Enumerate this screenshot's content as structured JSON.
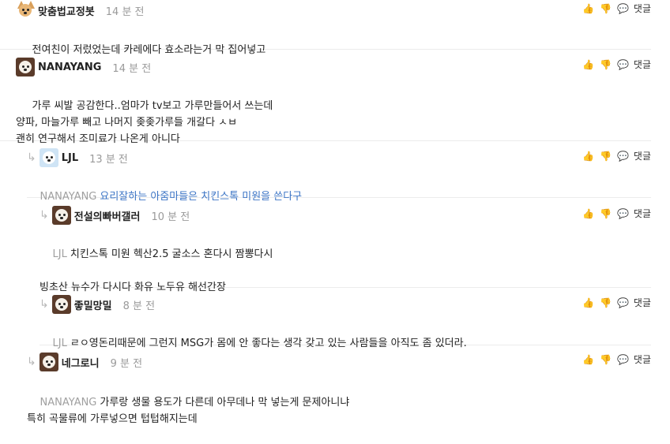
{
  "actions": {
    "like_icon": "thumbs-up-icon",
    "dislike_icon": "thumbs-down-icon",
    "reply_icon": "speech-bubble-icon",
    "reply_label": "댓글"
  },
  "comments": [
    {
      "name": "맞춤법교정봇",
      "time": "14 분 전",
      "avatar": "shiba",
      "mention": "",
      "text": "전여친이 저렀었는데 카레에다 효소라는거 막 집어넣고"
    },
    {
      "name": "NANAYANG",
      "time": "14 분 전",
      "avatar": "dog",
      "mention": "",
      "text": "가루 씨발 공감한다..엄마가 tv보고 가루만들어서 쓰는데\n양파, 마늘가루 빼고 나머지 좆좆가루들 개갈다 ㅅㅂ\n괜히 연구해서 조미료가 나온게 아니다"
    },
    {
      "name": "LJL",
      "time": "13 분 전",
      "avatar": "blue",
      "mention": "NANAYANG",
      "text": "요리잘하는 아줌마들은 치킨스톡 미원을 쓴다구"
    },
    {
      "name": "전설의빠버갤러",
      "time": "10 분 전",
      "avatar": "dog",
      "mention": "LJL",
      "text": "치킨스톡 미원 헥산2.5 굴소스 혼다시 짬뽕다시\n\n빙초산 뉴수가 다시다 화유 노두유 해선간장"
    },
    {
      "name": "좋밀망밀",
      "time": "8 분 전",
      "avatar": "dog",
      "mention": "LJL",
      "text": "ㄹㅇ영돈리때문에 그런지 MSG가 몸에 안 좋다는 생각 갖고 있는 사람들을 아직도 좀 있더라."
    },
    {
      "name": "네그로니",
      "time": "9 분 전",
      "avatar": "dog",
      "mention": "NANAYANG",
      "text": "가루랑 생물 용도가 다른데 아무데나 막 넣는게 문제아니냐\n특히 곡물류에 가루넣으면 텁텁해지는데"
    }
  ]
}
